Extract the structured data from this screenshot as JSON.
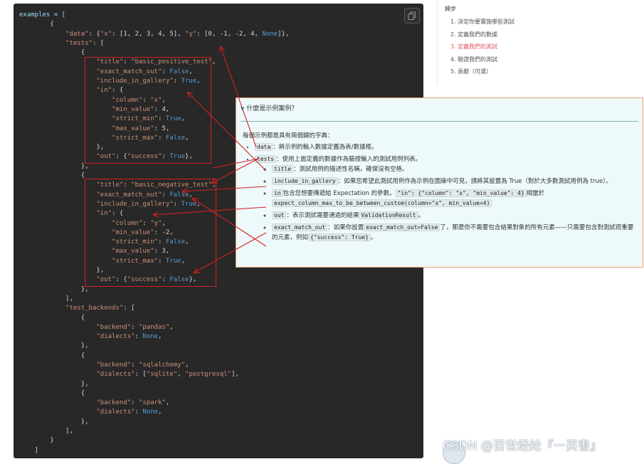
{
  "code": {
    "lines": [
      [
        {
          "t": "examples = [",
          "c": "#9cdcfe"
        }
      ],
      [
        {
          "t": "        {",
          "c": "#d4d4d4"
        }
      ],
      [
        {
          "t": "            \"data\"",
          "c": "#ce9178"
        },
        {
          "t": ": {",
          "c": "#d4d4d4"
        },
        {
          "t": "\"x\"",
          "c": "#ce9178"
        },
        {
          "t": ": [1, 2, 3, 4, 5], ",
          "c": "#d4d4d4"
        },
        {
          "t": "\"y\"",
          "c": "#ce9178"
        },
        {
          "t": ": [0, -1, -2, 4, ",
          "c": "#d4d4d4"
        },
        {
          "t": "None",
          "c": "#569cd6"
        },
        {
          "t": "]},",
          "c": "#d4d4d4"
        }
      ],
      [
        {
          "t": "            \"tests\"",
          "c": "#ce9178"
        },
        {
          "t": ": [",
          "c": "#d4d4d4"
        }
      ],
      [
        {
          "t": "                {",
          "c": "#d4d4d4"
        }
      ],
      [
        {
          "t": "                    \"title\"",
          "c": "#ce9178"
        },
        {
          "t": ": ",
          "c": "#d4d4d4"
        },
        {
          "t": "\"basic_positive_test\"",
          "c": "#ce9178"
        },
        {
          "t": ",",
          "c": "#d4d4d4"
        }
      ],
      [
        {
          "t": "                    \"exact_match_out\"",
          "c": "#ce9178"
        },
        {
          "t": ": ",
          "c": "#d4d4d4"
        },
        {
          "t": "False",
          "c": "#569cd6"
        },
        {
          "t": ",",
          "c": "#d4d4d4"
        }
      ],
      [
        {
          "t": "                    \"include_in_gallery\"",
          "c": "#ce9178"
        },
        {
          "t": ": ",
          "c": "#d4d4d4"
        },
        {
          "t": "True",
          "c": "#569cd6"
        },
        {
          "t": ",",
          "c": "#d4d4d4"
        }
      ],
      [
        {
          "t": "                    \"in\"",
          "c": "#ce9178"
        },
        {
          "t": ": {",
          "c": "#d4d4d4"
        }
      ],
      [
        {
          "t": "                        \"column\"",
          "c": "#ce9178"
        },
        {
          "t": ": ",
          "c": "#d4d4d4"
        },
        {
          "t": "\"x\"",
          "c": "#ce9178"
        },
        {
          "t": ",",
          "c": "#d4d4d4"
        }
      ],
      [
        {
          "t": "                        \"min_value\"",
          "c": "#ce9178"
        },
        {
          "t": ": 4,",
          "c": "#d4d4d4"
        }
      ],
      [
        {
          "t": "                        \"strict_min\"",
          "c": "#ce9178"
        },
        {
          "t": ": ",
          "c": "#d4d4d4"
        },
        {
          "t": "True",
          "c": "#569cd6"
        },
        {
          "t": ",",
          "c": "#d4d4d4"
        }
      ],
      [
        {
          "t": "                        \"max_value\"",
          "c": "#ce9178"
        },
        {
          "t": ": 5,",
          "c": "#d4d4d4"
        }
      ],
      [
        {
          "t": "                        \"strict_max\"",
          "c": "#ce9178"
        },
        {
          "t": ": ",
          "c": "#d4d4d4"
        },
        {
          "t": "False",
          "c": "#569cd6"
        },
        {
          "t": ",",
          "c": "#d4d4d4"
        }
      ],
      [
        {
          "t": "                    },",
          "c": "#d4d4d4"
        }
      ],
      [
        {
          "t": "                    \"out\"",
          "c": "#ce9178"
        },
        {
          "t": ": {",
          "c": "#d4d4d4"
        },
        {
          "t": "\"success\"",
          "c": "#ce9178"
        },
        {
          "t": ": ",
          "c": "#d4d4d4"
        },
        {
          "t": "True",
          "c": "#569cd6"
        },
        {
          "t": "},",
          "c": "#d4d4d4"
        }
      ],
      [
        {
          "t": "                },",
          "c": "#d4d4d4"
        }
      ],
      [
        {
          "t": "                {",
          "c": "#d4d4d4"
        }
      ],
      [
        {
          "t": "                    \"title\"",
          "c": "#ce9178"
        },
        {
          "t": ": ",
          "c": "#d4d4d4"
        },
        {
          "t": "\"basic_negative_test\"",
          "c": "#ce9178"
        },
        {
          "t": ",",
          "c": "#d4d4d4"
        }
      ],
      [
        {
          "t": "                    \"exact_match_out\"",
          "c": "#ce9178"
        },
        {
          "t": ": ",
          "c": "#d4d4d4"
        },
        {
          "t": "False",
          "c": "#569cd6"
        },
        {
          "t": ",",
          "c": "#d4d4d4"
        }
      ],
      [
        {
          "t": "                    \"include_in_gallery\"",
          "c": "#ce9178"
        },
        {
          "t": ": ",
          "c": "#d4d4d4"
        },
        {
          "t": "True",
          "c": "#569cd6"
        },
        {
          "t": ",",
          "c": "#d4d4d4"
        }
      ],
      [
        {
          "t": "                    \"in\"",
          "c": "#ce9178"
        },
        {
          "t": ": {",
          "c": "#d4d4d4"
        }
      ],
      [
        {
          "t": "                        \"column\"",
          "c": "#ce9178"
        },
        {
          "t": ": ",
          "c": "#d4d4d4"
        },
        {
          "t": "\"y\"",
          "c": "#ce9178"
        },
        {
          "t": ",",
          "c": "#d4d4d4"
        }
      ],
      [
        {
          "t": "                        \"min_value\"",
          "c": "#ce9178"
        },
        {
          "t": ": -2,",
          "c": "#d4d4d4"
        }
      ],
      [
        {
          "t": "                        \"strict_min\"",
          "c": "#ce9178"
        },
        {
          "t": ": ",
          "c": "#d4d4d4"
        },
        {
          "t": "False",
          "c": "#569cd6"
        },
        {
          "t": ",",
          "c": "#d4d4d4"
        }
      ],
      [
        {
          "t": "                        \"max_value\"",
          "c": "#ce9178"
        },
        {
          "t": ": 3,",
          "c": "#d4d4d4"
        }
      ],
      [
        {
          "t": "                        \"strict_max\"",
          "c": "#ce9178"
        },
        {
          "t": ": ",
          "c": "#d4d4d4"
        },
        {
          "t": "True",
          "c": "#569cd6"
        },
        {
          "t": ",",
          "c": "#d4d4d4"
        }
      ],
      [
        {
          "t": "                    },",
          "c": "#d4d4d4"
        }
      ],
      [
        {
          "t": "                    \"out\"",
          "c": "#ce9178"
        },
        {
          "t": ": {",
          "c": "#d4d4d4"
        },
        {
          "t": "\"success\"",
          "c": "#ce9178"
        },
        {
          "t": ": ",
          "c": "#d4d4d4"
        },
        {
          "t": "False",
          "c": "#569cd6"
        },
        {
          "t": "},",
          "c": "#d4d4d4"
        }
      ],
      [
        {
          "t": "                },",
          "c": "#d4d4d4"
        }
      ],
      [
        {
          "t": "            ],",
          "c": "#d4d4d4"
        }
      ],
      [
        {
          "t": "            \"test_backends\"",
          "c": "#ce9178"
        },
        {
          "t": ": [",
          "c": "#d4d4d4"
        }
      ],
      [
        {
          "t": "                {",
          "c": "#d4d4d4"
        }
      ],
      [
        {
          "t": "                    \"backend\"",
          "c": "#ce9178"
        },
        {
          "t": ": ",
          "c": "#d4d4d4"
        },
        {
          "t": "\"pandas\"",
          "c": "#ce9178"
        },
        {
          "t": ",",
          "c": "#d4d4d4"
        }
      ],
      [
        {
          "t": "                    \"dialects\"",
          "c": "#ce9178"
        },
        {
          "t": ": ",
          "c": "#d4d4d4"
        },
        {
          "t": "None",
          "c": "#569cd6"
        },
        {
          "t": ",",
          "c": "#d4d4d4"
        }
      ],
      [
        {
          "t": "                },",
          "c": "#d4d4d4"
        }
      ],
      [
        {
          "t": "                {",
          "c": "#d4d4d4"
        }
      ],
      [
        {
          "t": "                    \"backend\"",
          "c": "#ce9178"
        },
        {
          "t": ": ",
          "c": "#d4d4d4"
        },
        {
          "t": "\"sqlalchemy\"",
          "c": "#ce9178"
        },
        {
          "t": ",",
          "c": "#d4d4d4"
        }
      ],
      [
        {
          "t": "                    \"dialects\"",
          "c": "#ce9178"
        },
        {
          "t": ": [",
          "c": "#d4d4d4"
        },
        {
          "t": "\"sqlite\"",
          "c": "#ce9178"
        },
        {
          "t": ", ",
          "c": "#d4d4d4"
        },
        {
          "t": "\"postgresql\"",
          "c": "#ce9178"
        },
        {
          "t": "],",
          "c": "#d4d4d4"
        }
      ],
      [
        {
          "t": "                },",
          "c": "#d4d4d4"
        }
      ],
      [
        {
          "t": "                {",
          "c": "#d4d4d4"
        }
      ],
      [
        {
          "t": "                    \"backend\"",
          "c": "#ce9178"
        },
        {
          "t": ": ",
          "c": "#d4d4d4"
        },
        {
          "t": "\"spark\"",
          "c": "#ce9178"
        },
        {
          "t": ",",
          "c": "#d4d4d4"
        }
      ],
      [
        {
          "t": "                    \"dialects\"",
          "c": "#ce9178"
        },
        {
          "t": ": ",
          "c": "#d4d4d4"
        },
        {
          "t": "None",
          "c": "#569cd6"
        },
        {
          "t": ",",
          "c": "#d4d4d4"
        }
      ],
      [
        {
          "t": "                },",
          "c": "#d4d4d4"
        }
      ],
      [
        {
          "t": "            ],",
          "c": "#d4d4d4"
        }
      ],
      [
        {
          "t": "        }",
          "c": "#d4d4d4"
        }
      ],
      [
        {
          "t": "    ]",
          "c": "#d4d4d4"
        }
      ]
    ],
    "copy_icon": "copy-icon"
  },
  "toc": {
    "heading": "歸步",
    "items": [
      {
        "label": "1. 決定你要實施哪些測試",
        "active": false
      },
      {
        "label": "2. 定義我們的數據",
        "active": false
      },
      {
        "label": "3. 定義我們的測試",
        "active": true
      },
      {
        "label": "4. 驗證我們的測試",
        "active": false
      },
      {
        "label": "5. 貢獻（可選）",
        "active": false
      }
    ]
  },
  "tip": {
    "title": "什麼是示例案例？",
    "chevron_icon": "chevron-down-icon",
    "intro": "每個示例都是具有兩個鍵的字典：",
    "data_code": "data",
    "data_text": "：將示例的輸入數據定義為表/數據框。",
    "tests_code": "tests",
    "tests_text": "：使用上面定義的數據作為驗證輸入的測試用例列表。",
    "title_code": "title",
    "title_text": "：測試用例的描述性名稱，確保沒有空格。",
    "gallery_code": "include_in_gallery",
    "gallery_text": "：如果您希望此測試用例作為示例在圖庫中可見，請將其設置為 True（對於大多數測試用例為 true）。",
    "in_code": "in",
    "in_text1": "包含您想要傳遞給 Expectation 的參數。",
    "in_code2": "\"in\": {\"column\": \"x\", \"min_value\": 4}",
    "in_text2": "相當於",
    "in_code3": "expect_column_max_to_be_between_custom(column=\"x\", min_value=4)",
    "out_code": "out",
    "out_text": "：表示測試需要通過的結果",
    "out_code2": "ValidationResult",
    "out_text2": "。",
    "exact_code": "exact_match_out",
    "exact_text1": "：如果你設置",
    "exact_code2": "exact_match_out=False",
    "exact_text2": "了，那麼你不需要包含結果對象的所有元素——只需要包含對測試很重要的元素，例如",
    "exact_code3": "{\"success\": True}",
    "exact_text3": "。"
  },
  "watermark": "CSDN @百世经纶『一页書』",
  "annotation_color": "#d32020"
}
